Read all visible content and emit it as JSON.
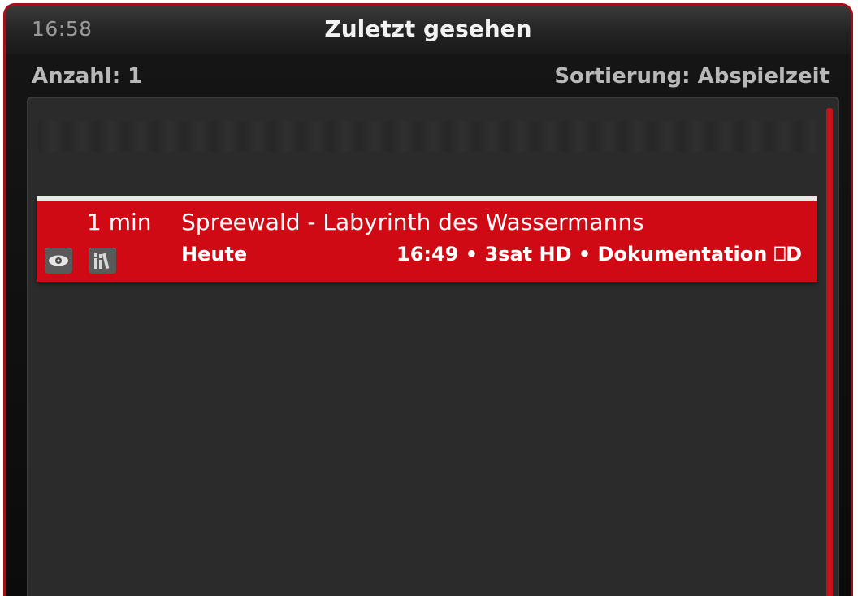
{
  "header": {
    "clock": "16:58",
    "title": "Zuletzt gesehen"
  },
  "info": {
    "count": "Anzahl: 1",
    "sorting": "Sortierung: Abspielzeit"
  },
  "list": {
    "items": [
      {
        "duration": "1 min",
        "title": "Spreewald - Labyrinth des Wassermanns",
        "day": "Heute",
        "details": "16:49 • 3sat HD • Dokumentation ⎕D",
        "icons": [
          "eye-icon",
          "library-icon"
        ]
      }
    ]
  },
  "colors": {
    "accent": "#d00a14",
    "frame_border": "#a01018",
    "panel": "#2b2b2b"
  }
}
